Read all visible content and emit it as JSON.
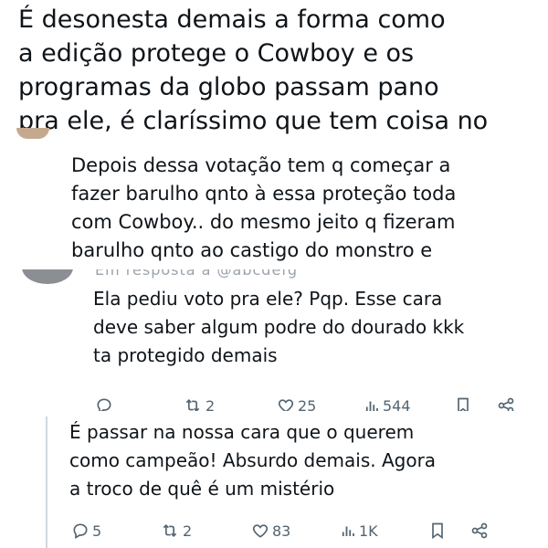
{
  "tweet_main": {
    "text": "É desonesta demais a forma como\na edição protege o Cowboy e os\nprogramas da globo passam pano\npra ele, é claríssimo que tem coisa no"
  },
  "reply_1": {
    "text": "Depois dessa votação tem q começar a\nfazer barulho qnto à essa proteção toda\ncom Cowboy.. do mesmo jeito q fizeram\nbarulho qnto ao castigo do monstro e"
  },
  "reply_2": {
    "replying_to": "Em resposta a @abcdefg",
    "text": "Ela pediu voto pra ele? Pqp. Esse cara\ndeve saber algum podre do dourado kkk\nta protegido demais",
    "actions": {
      "replies": "",
      "retweets": "2",
      "likes": "25",
      "views": "544"
    }
  },
  "reply_3": {
    "text": "É passar na nossa cara que o querem\ncomo campeão! Absurdo demais. Agora\na troco de quê é um mistério",
    "actions": {
      "replies": "5",
      "retweets": "2",
      "likes": "83",
      "views": "1K"
    }
  },
  "icons": {
    "reply": "reply-icon",
    "retweet": "retweet-icon",
    "like": "heart-icon",
    "views": "views-icon",
    "bookmark": "bookmark-icon",
    "share": "share-icon"
  },
  "colors": {
    "text": "#0f1419",
    "muted": "#536471",
    "divider": "#cfd9de"
  }
}
